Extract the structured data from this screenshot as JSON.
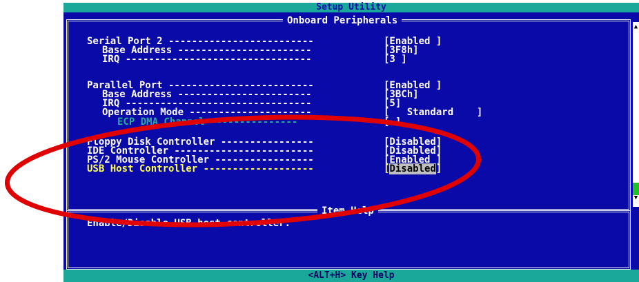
{
  "title": "Setup Utility",
  "section_title": "Onboard Peripherals",
  "help_section_title": "Item Help",
  "help_text": "Enable/Disable USB host controller.",
  "bottom_bar": "<ALT+H>  Key Help",
  "items": {
    "serial_port_2": {
      "label": "Serial Port 2 -------------------------",
      "value": "[Enabled ]"
    },
    "serial_base": {
      "label": "Base Address -----------------------",
      "value": "[3F8h]"
    },
    "serial_irq": {
      "label": "IRQ --------------------------------",
      "value": "[3 ]"
    },
    "parallel_port": {
      "label": "Parallel Port -------------------------",
      "value": "[Enabled ]"
    },
    "parallel_base": {
      "label": "Base Address -----------------------",
      "value": "[3BCh]"
    },
    "parallel_irq": {
      "label": "IRQ --------------------------------",
      "value": "[5]"
    },
    "operation_mode": {
      "label": "Operation Mode ---------------------",
      "value": "[   Standard    ]"
    },
    "ecp_dma": {
      "label": "ECP DMA Channel ---------------",
      "value": "[ ]"
    },
    "floppy": {
      "label": "Floppy Disk Controller ----------------",
      "value": "[Disabled]"
    },
    "ide": {
      "label": "IDE Controller ------------------------",
      "value": "[Disabled]"
    },
    "ps2": {
      "label": "PS/2 Mouse Controller -----------------",
      "value": "[Enabled ]"
    },
    "usb_label": "USB Host Controller -------------------",
    "usb_open": "[",
    "usb_value": "Disabled",
    "usb_close": "]"
  },
  "colors": {
    "background": "#0a0aa8",
    "title_bar": "#1aa89a",
    "annotation": "#e00000",
    "highlight_text": "#ffff55"
  }
}
